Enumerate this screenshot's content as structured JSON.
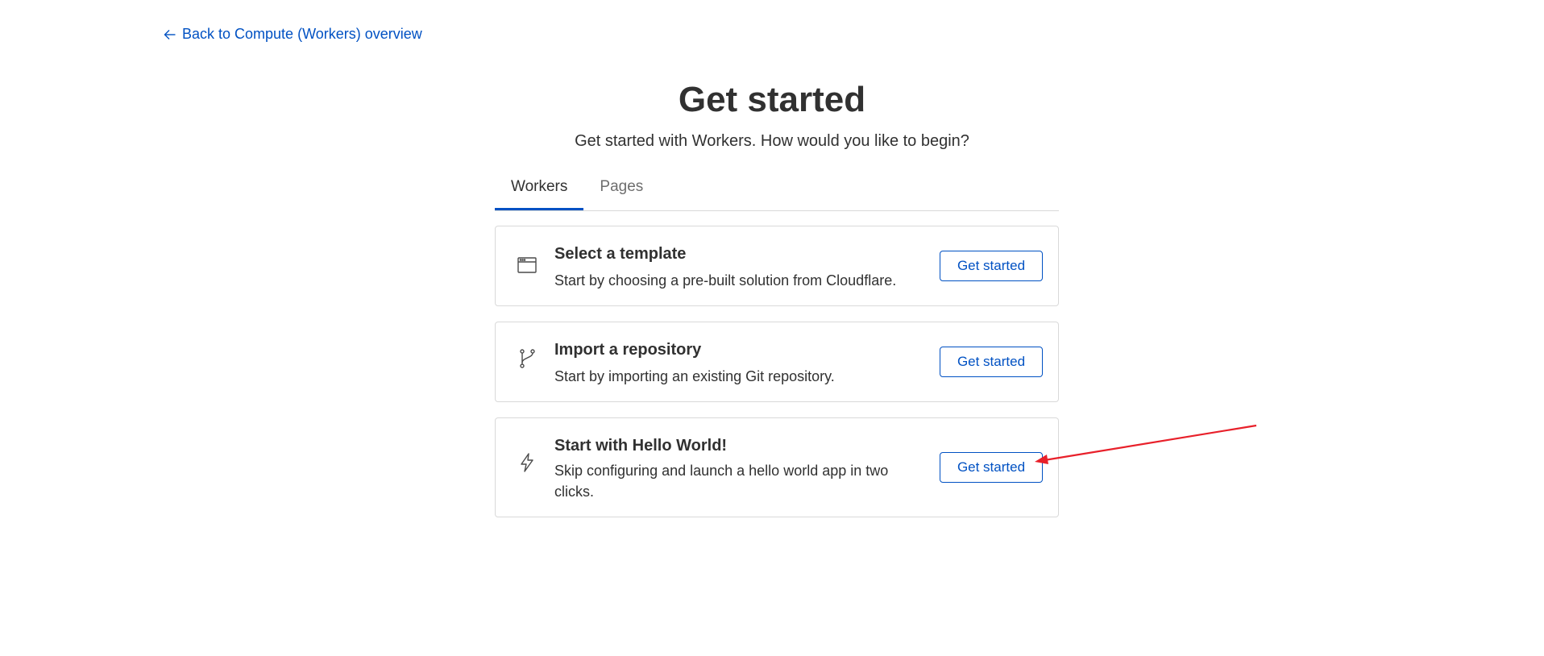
{
  "back_link": {
    "label": "Back to Compute (Workers) overview",
    "icon": "arrow-left-icon"
  },
  "header": {
    "title": "Get started",
    "subtitle": "Get started with Workers. How would you like to begin?"
  },
  "tabs": [
    {
      "label": "Workers",
      "active": true
    },
    {
      "label": "Pages",
      "active": false
    }
  ],
  "cards": [
    {
      "icon": "browser-window-icon",
      "title": "Select a template",
      "description": "Start by choosing a pre-built solution from Cloudflare.",
      "button_label": "Get started"
    },
    {
      "icon": "git-branch-icon",
      "title": "Import a repository",
      "description": "Start by importing an existing Git repository.",
      "button_label": "Get started"
    },
    {
      "icon": "lightning-bolt-icon",
      "title": "Start with Hello World!",
      "description": "Skip configuring and launch a hello world app in two clicks.",
      "button_label": "Get started"
    }
  ],
  "colors": {
    "accent": "#0051c3",
    "text": "#313131",
    "border": "#d9d9d9",
    "annotation_arrow": "#e8202a"
  }
}
